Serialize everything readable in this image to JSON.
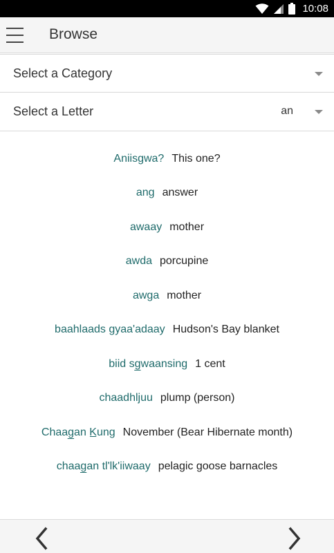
{
  "status_bar": {
    "time": "10:08",
    "icons": [
      "wifi-icon",
      "signal-icon",
      "battery-icon"
    ]
  },
  "header": {
    "title": "Browse",
    "menu_icon": "hamburger-menu-icon"
  },
  "filters": {
    "category": {
      "label": "Select a Category",
      "value": ""
    },
    "letter": {
      "label": "Select a Letter",
      "value": "an"
    }
  },
  "entries": [
    {
      "term": "Aniisgwa?",
      "definition": "This one?"
    },
    {
      "term": "ang",
      "definition": "answer"
    },
    {
      "term": "awaay",
      "definition": "mother"
    },
    {
      "term": "awda",
      "definition": "porcupine"
    },
    {
      "term": "awga",
      "definition": "mother"
    },
    {
      "term": "baahlaads gyaa'adaay",
      "definition": "Hudson's Bay blanket"
    },
    {
      "term": "biid sg̲waansing",
      "definition": "1 cent"
    },
    {
      "term": "chaadhljuu",
      "definition": "plump (person)"
    },
    {
      "term": "Chaag̲an K̲ung",
      "definition": "November (Bear Hibernate month)"
    },
    {
      "term": "chaag̲an tl'lk'iiwaay",
      "definition": "pelagic goose barnacles"
    }
  ],
  "pagination": {
    "prev_icon": "chevron-left-icon",
    "next_icon": "chevron-right-icon"
  },
  "colors": {
    "term": "#1f6b6b",
    "status_bar": "#000000",
    "app_bar": "#f5f5f5"
  }
}
